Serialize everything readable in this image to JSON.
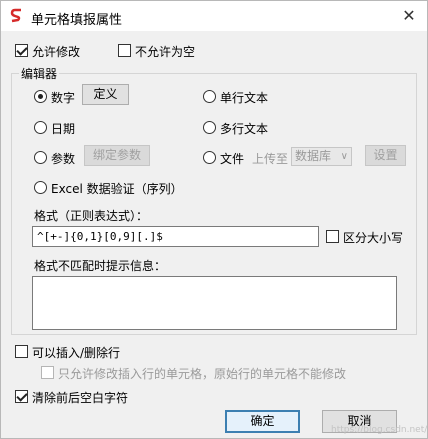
{
  "window": {
    "title": "单元格填报属性",
    "close_glyph": "✕"
  },
  "options": {
    "allow_edit": {
      "label": "允许修改",
      "checked": true
    },
    "disallow_empty": {
      "label": "不允许为空",
      "checked": false
    }
  },
  "editor": {
    "legend": "编辑器",
    "number": {
      "label": "数字",
      "selected": true
    },
    "define_button": "定义",
    "date": {
      "label": "日期",
      "selected": false
    },
    "param": {
      "label": "参数",
      "selected": false
    },
    "bind_param_button": "绑定参数",
    "single_text": {
      "label": "单行文本",
      "selected": false
    },
    "multi_text": {
      "label": "多行文本",
      "selected": false
    },
    "file": {
      "label": "文件",
      "selected": false
    },
    "upload_to_label": "上传至",
    "upload_target": "数据库",
    "settings_button": "设置",
    "excel_validation": {
      "label": "Excel 数据验证（序列）",
      "selected": false
    }
  },
  "format": {
    "label": "格式（正则表达式）：",
    "value": "^[+-]{0,1}[0,9][.]$",
    "case_sensitive": {
      "label": "区分大小写",
      "checked": false
    },
    "mismatch_label": "格式不匹配时提示信息：",
    "mismatch_value": ""
  },
  "rows": {
    "insert_delete": {
      "label": "可以插入/删除行",
      "checked": false
    },
    "only_inserted": {
      "label": "只允许修改插入行的单元格，原始行的单元格不能修改",
      "checked": false
    }
  },
  "trim": {
    "label": "清除前后空白字符",
    "checked": true
  },
  "buttons": {
    "ok": "确定",
    "cancel": "取消"
  },
  "watermark": "https://blog.csdn.net/..."
}
